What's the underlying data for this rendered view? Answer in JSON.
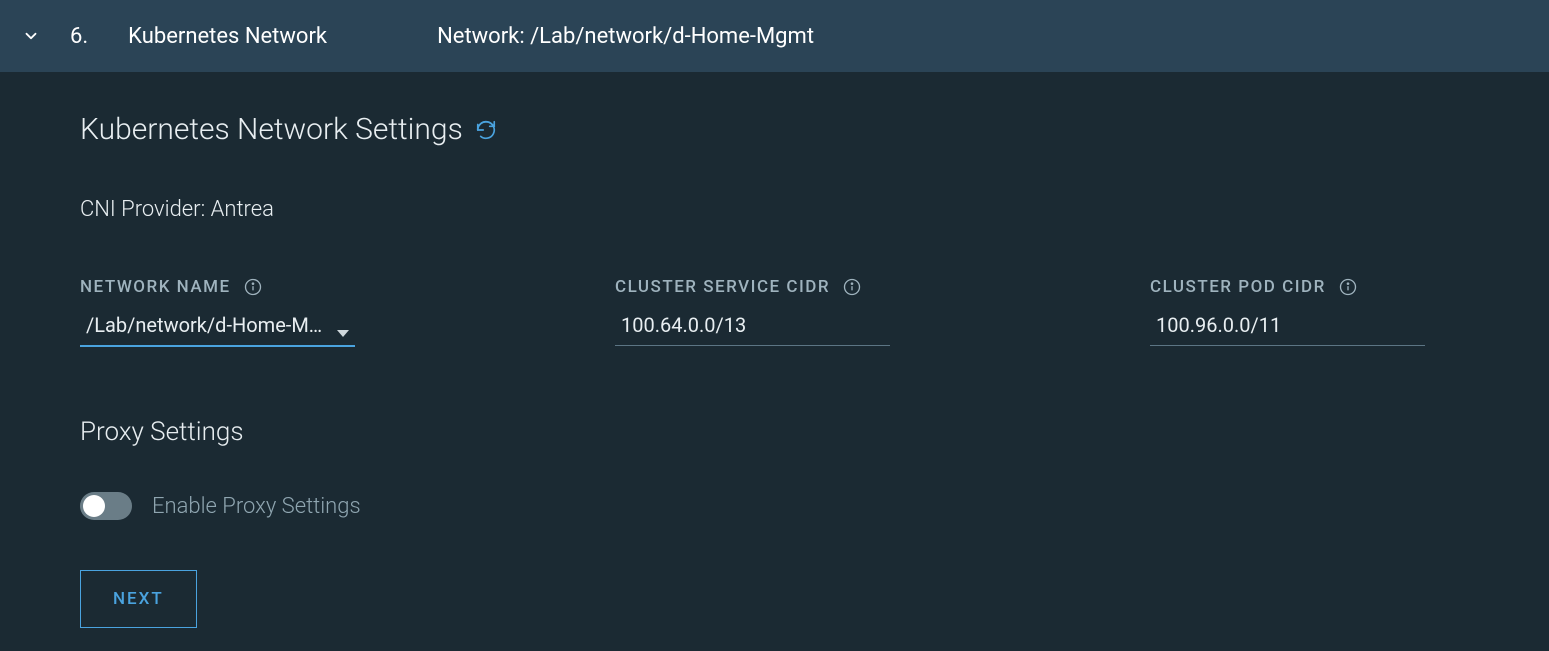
{
  "header": {
    "step_number": "6.",
    "step_title": "Kubernetes Network",
    "summary": "Network: /Lab/network/d-Home-Mgmt"
  },
  "page": {
    "title": "Kubernetes Network Settings",
    "cni_label": "CNI Provider:",
    "cni_value": "Antrea"
  },
  "form": {
    "network_name": {
      "label": "NETWORK NAME",
      "value": "/Lab/network/d-Home-Mgmt"
    },
    "cluster_service_cidr": {
      "label": "CLUSTER SERVICE CIDR",
      "value": "100.64.0.0/13"
    },
    "cluster_pod_cidr": {
      "label": "CLUSTER POD CIDR",
      "value": "100.96.0.0/11"
    }
  },
  "proxy": {
    "title": "Proxy Settings",
    "toggle_label": "Enable Proxy Settings",
    "enabled": false
  },
  "actions": {
    "next": "NEXT"
  }
}
